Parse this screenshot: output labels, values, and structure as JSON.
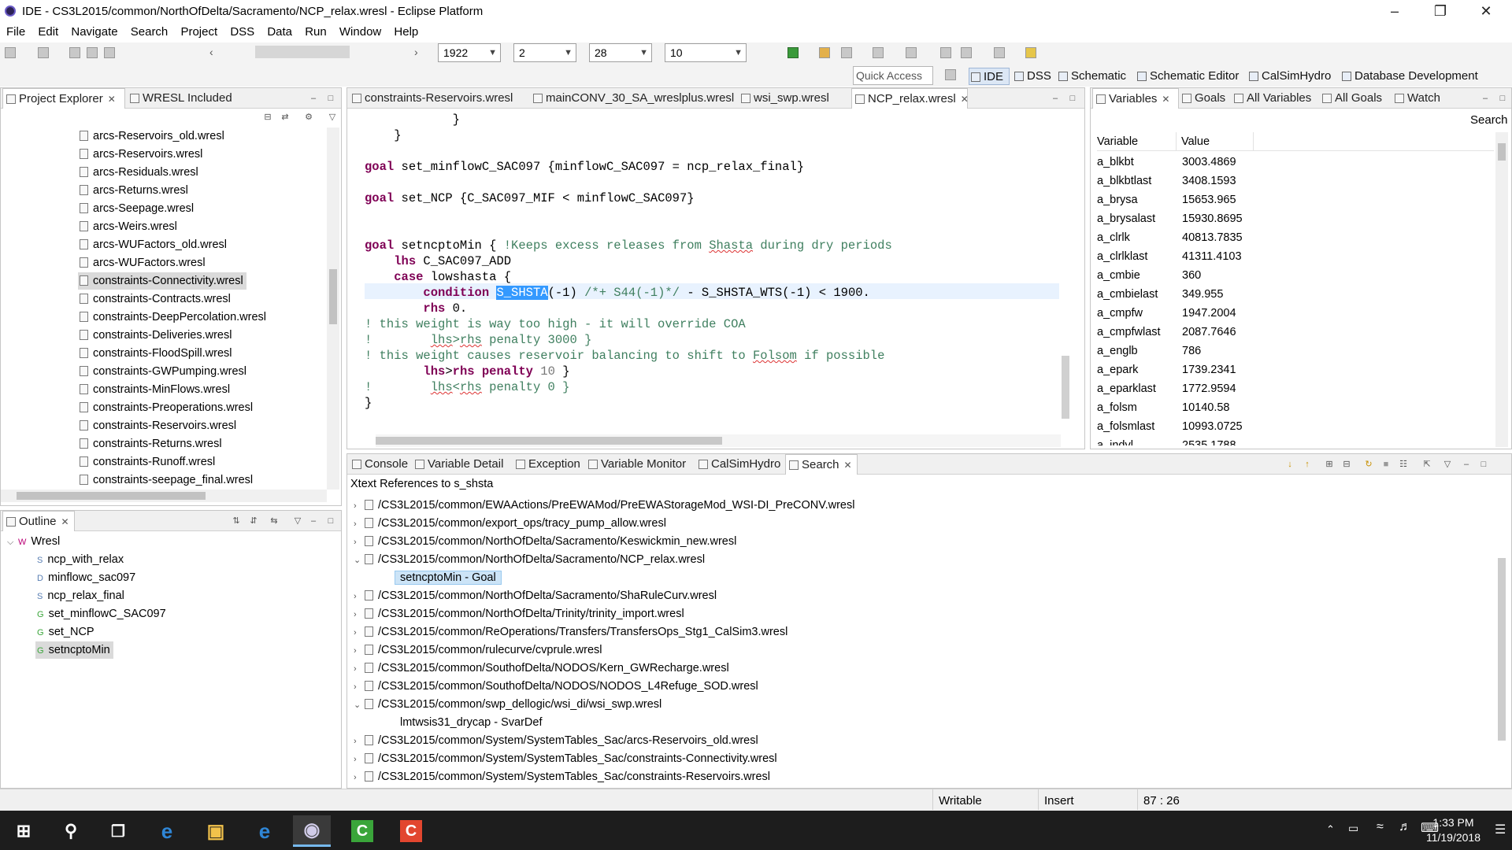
{
  "window": {
    "title": "IDE - CS3L2015/common/NorthOfDelta/Sacramento/NCP_relax.wresl - Eclipse Platform"
  },
  "menubar": [
    "File",
    "Edit",
    "Navigate",
    "Search",
    "Project",
    "DSS",
    "Data",
    "Run",
    "Window",
    "Help"
  ],
  "toolbar": {
    "combo1": "1922",
    "combo2": "2",
    "combo3": "28",
    "combo4": "10",
    "quick_access": "Quick Access"
  },
  "perspectives": [
    "IDE",
    "DSS",
    "Schematic",
    "Schematic Editor",
    "CalSimHydro",
    "Database Development"
  ],
  "project_explorer": {
    "tabs": [
      "Project Explorer",
      "WRESL Included"
    ],
    "files": [
      "arcs-Reservoirs_old.wresl",
      "arcs-Reservoirs.wresl",
      "arcs-Residuals.wresl",
      "arcs-Returns.wresl",
      "arcs-Seepage.wresl",
      "arcs-Weirs.wresl",
      "arcs-WUFactors_old.wresl",
      "arcs-WUFactors.wresl",
      "constraints-Connectivity.wresl",
      "constraints-Contracts.wresl",
      "constraints-DeepPercolation.wresl",
      "constraints-Deliveries.wresl",
      "constraints-FloodSpill.wresl",
      "constraints-GWPumping.wresl",
      "constraints-MinFlows.wresl",
      "constraints-Preoperations.wresl",
      "constraints-Reservoirs.wresl",
      "constraints-Returns.wresl",
      "constraints-Runoff.wresl",
      "constraints-seepage_final.wresl"
    ],
    "selected": "constraints-Connectivity.wresl"
  },
  "outline": {
    "tab": "Outline",
    "root": "Wresl",
    "items": [
      {
        "badge": "S",
        "label": "ncp_with_relax"
      },
      {
        "badge": "D",
        "label": "minflowc_sac097"
      },
      {
        "badge": "S",
        "label": "ncp_relax_final"
      },
      {
        "badge": "G",
        "label": "set_minflowC_SAC097"
      },
      {
        "badge": "G",
        "label": "set_NCP"
      },
      {
        "badge": "G",
        "label": "setncptoMin"
      }
    ],
    "selected": "setncptoMin"
  },
  "editor": {
    "tabs": [
      "constraints-Reservoirs.wresl",
      "mainCONV_30_SA_wreslplus.wresl",
      "wsi_swp.wresl",
      "NCP_relax.wresl"
    ],
    "active": "NCP_relax.wresl"
  },
  "variables": {
    "tabs": [
      "Variables",
      "Goals",
      "All Variables",
      "All Goals",
      "Watch"
    ],
    "search_label": "Search",
    "col_variable": "Variable",
    "col_value": "Value",
    "rows": [
      [
        "a_blkbt",
        "3003.4869"
      ],
      [
        "a_blkbtlast",
        "3408.1593"
      ],
      [
        "a_brysa",
        "15653.965"
      ],
      [
        "a_brysalast",
        "15930.8695"
      ],
      [
        "a_clrlk",
        "40813.7835"
      ],
      [
        "a_clrlklast",
        "41311.4103"
      ],
      [
        "a_cmbie",
        "360"
      ],
      [
        "a_cmbielast",
        "349.955"
      ],
      [
        "a_cmpfw",
        "1947.2004"
      ],
      [
        "a_cmpfwlast",
        "2087.7646"
      ],
      [
        "a_englb",
        "786"
      ],
      [
        "a_epark",
        "1739.2341"
      ],
      [
        "a_eparklast",
        "1772.9594"
      ],
      [
        "a_folsm",
        "10140.58"
      ],
      [
        "a_folsmlast",
        "10993.0725"
      ],
      [
        "a_indvl",
        "2535.1788"
      ]
    ]
  },
  "bottom": {
    "tabs": [
      "Console",
      "Variable Detail",
      "Exception",
      "Variable Monitor",
      "CalSimHydro",
      "Search"
    ],
    "active": "Search",
    "heading": "Xtext References to s_shsta",
    "results": [
      {
        "text": "/CS3L2015/common/EWAActions/PreEWAMod/PreEWAStorageMod_WSI-DI_PreCONV.wresl",
        "expanded": false,
        "child": false
      },
      {
        "text": "/CS3L2015/common/export_ops/tracy_pump_allow.wresl",
        "expanded": false,
        "child": false
      },
      {
        "text": "/CS3L2015/common/NorthOfDelta/Sacramento/Keswickmin_new.wresl",
        "expanded": false,
        "child": false
      },
      {
        "text": "/CS3L2015/common/NorthOfDelta/Sacramento/NCP_relax.wresl",
        "expanded": true,
        "child": false
      },
      {
        "text": "setncptoMin - Goal",
        "expanded": false,
        "child": true,
        "selected": true
      },
      {
        "text": "/CS3L2015/common/NorthOfDelta/Sacramento/ShaRuleCurv.wresl",
        "expanded": false,
        "child": false
      },
      {
        "text": "/CS3L2015/common/NorthOfDelta/Trinity/trinity_import.wresl",
        "expanded": false,
        "child": false
      },
      {
        "text": "/CS3L2015/common/ReOperations/Transfers/TransfersOps_Stg1_CalSim3.wresl",
        "expanded": false,
        "child": false
      },
      {
        "text": "/CS3L2015/common/rulecurve/cvprule.wresl",
        "expanded": false,
        "child": false
      },
      {
        "text": "/CS3L2015/common/SouthofDelta/NODOS/Kern_GWRecharge.wresl",
        "expanded": false,
        "child": false
      },
      {
        "text": "/CS3L2015/common/SouthofDelta/NODOS/NODOS_L4Refuge_SOD.wresl",
        "expanded": false,
        "child": false
      },
      {
        "text": "/CS3L2015/common/swp_dellogic/wsi_di/wsi_swp.wresl",
        "expanded": true,
        "child": false
      },
      {
        "text": "lmtwsis31_drycap - SvarDef",
        "expanded": false,
        "child": true
      },
      {
        "text": "/CS3L2015/common/System/SystemTables_Sac/arcs-Reservoirs_old.wresl",
        "expanded": false,
        "child": false
      },
      {
        "text": "/CS3L2015/common/System/SystemTables_Sac/constraints-Connectivity.wresl",
        "expanded": false,
        "child": false
      },
      {
        "text": "/CS3L2015/common/System/SystemTables_Sac/constraints-Reservoirs.wresl",
        "expanded": false,
        "child": false
      }
    ]
  },
  "status": {
    "mode": "Writable",
    "insert": "Insert",
    "position": "87 : 26"
  },
  "taskbar": {
    "time": "1:33 PM",
    "date": "11/19/2018"
  }
}
